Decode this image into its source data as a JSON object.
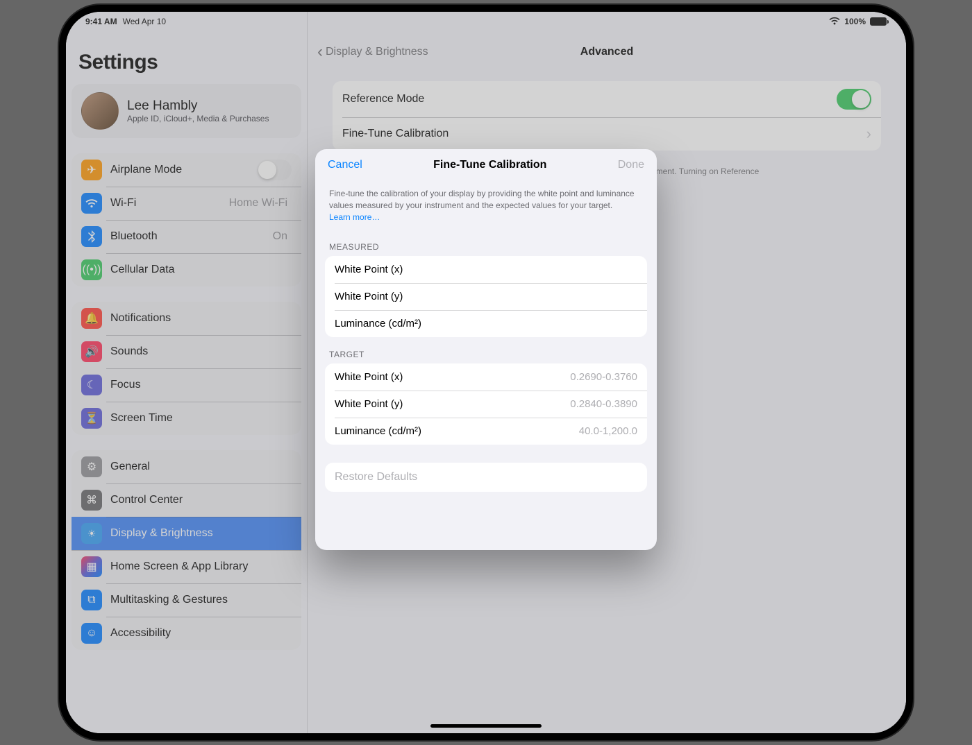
{
  "status": {
    "time": "9:41 AM",
    "date": "Wed Apr 10",
    "battery": "100%"
  },
  "sidebar": {
    "title": "Settings",
    "profile": {
      "name": "Lee Hambly",
      "subtitle": "Apple ID, iCloud+, Media & Purchases"
    },
    "g1": {
      "airplane": "Airplane Mode",
      "wifi": "Wi-Fi",
      "wifi_value": "Home Wi-Fi",
      "bluetooth": "Bluetooth",
      "bluetooth_value": "On",
      "cellular": "Cellular Data"
    },
    "g2": {
      "notifications": "Notifications",
      "sounds": "Sounds",
      "focus": "Focus",
      "screentime": "Screen Time"
    },
    "g3": {
      "general": "General",
      "controlcenter": "Control Center",
      "display": "Display & Brightness",
      "homescreen": "Home Screen & App Library",
      "multitasking": "Multitasking & Gestures",
      "accessibility": "Accessibility"
    }
  },
  "main": {
    "back": "Display & Brightness",
    "title": "Advanced",
    "reference_mode": "Reference Mode",
    "fine_tune": "Fine-Tune Calibration",
    "note": "Reference Mode delivers a consistent viewing experience across any lighting environment. Turning on Reference"
  },
  "sheet": {
    "cancel": "Cancel",
    "title": "Fine-Tune Calibration",
    "done": "Done",
    "desc": "Fine-tune the calibration of your display by providing the white point and luminance values measured by your instrument and the expected values for your target.",
    "learn_more": "Learn more…",
    "measured_header": "MEASURED",
    "measured": {
      "wpx": "White Point (x)",
      "wpy": "White Point (y)",
      "lum": "Luminance (cd/m²)"
    },
    "target_header": "TARGET",
    "target": {
      "wpx": "White Point (x)",
      "wpx_v": "0.2690-0.3760",
      "wpy": "White Point (y)",
      "wpy_v": "0.2840-0.3890",
      "lum": "Luminance (cd/m²)",
      "lum_v": "40.0-1,200.0"
    },
    "restore": "Restore Defaults"
  }
}
